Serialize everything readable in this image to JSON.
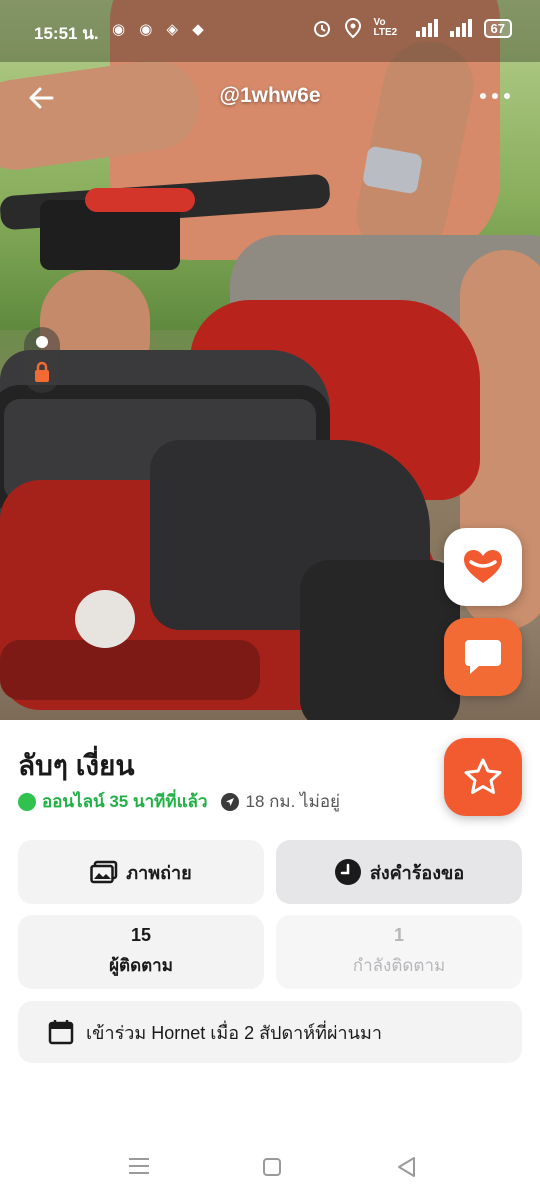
{
  "status_bar": {
    "time": "15:51 น.",
    "app_icons": "◉ ◉ ◈ ◆",
    "network_label": "Vo LTE2",
    "battery": "67"
  },
  "header": {
    "username": "@1whw6e"
  },
  "profile": {
    "name": "ลับๆ เงี่ยน",
    "online_status": "ออนไลน์ 35 นาทีที่แล้ว",
    "distance": "18 กม. ไม่อยู่"
  },
  "actions": {
    "photos_label": "ภาพถ่าย",
    "request_label": "ส่งคำร้องขอ"
  },
  "stats": {
    "followers_count": "15",
    "followers_label": "ผู้ติดตาม",
    "following_count": "1",
    "following_label": "กำลังติดตาม"
  },
  "joined": {
    "text": "เข้าร่วม Hornet เมื่อ 2 สัปดาห์ที่ผ่านมา"
  },
  "colors": {
    "accent": "#f26a34",
    "online": "#22b147"
  }
}
